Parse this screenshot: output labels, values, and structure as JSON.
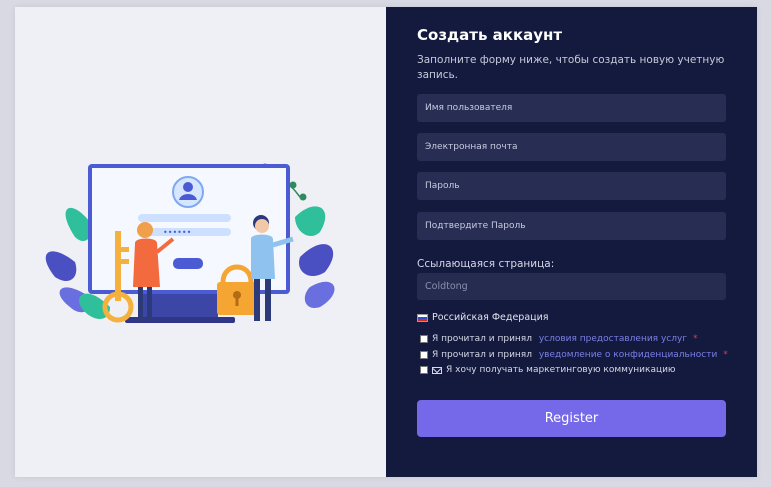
{
  "form": {
    "title": "Создать аккаунт",
    "subtitle": "Заполните форму ниже, чтобы создать новую учетную запись.",
    "fields": [
      {
        "placeholder": "Имя пользователя"
      },
      {
        "placeholder": "Электронная почта"
      },
      {
        "placeholder": "Пароль"
      },
      {
        "placeholder": "Подтвердите Пароль"
      }
    ],
    "referral_label": "Ссылающаяся страница:",
    "referral_value": "Coldtong",
    "country": "Российская Федерация",
    "checkboxes": [
      {
        "prefix": "Я прочитал и принял ",
        "link": "условия предоставления услуг",
        "required": "*"
      },
      {
        "prefix": "Я прочитал и принял ",
        "link": "уведомление о конфиденциальности",
        "required": "*"
      },
      {
        "label": "Я хочу получать маркетинговую коммуникацию"
      }
    ],
    "register_label": "Register"
  },
  "colors": {
    "panel_bg": "#141a3d",
    "input_bg": "#272d53",
    "accent": "#7669e9",
    "link": "#7b7fe8",
    "required": "#e53a4e",
    "illustration_bg": "#eef0f6"
  },
  "icons": [
    "russia-flag-icon",
    "mail-icon",
    "user-avatar-icon",
    "key-icon",
    "padlock-icon"
  ]
}
